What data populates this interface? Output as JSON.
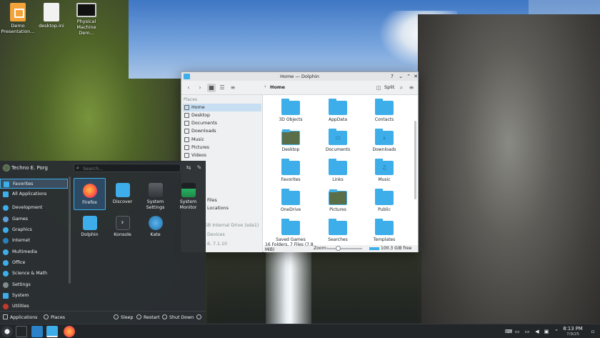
{
  "desktop": {
    "icons": [
      {
        "label_1": "Demo",
        "label_2": "Presentation...",
        "icon": "presentation-icon"
      },
      {
        "label_1": "desktop.ini",
        "label_2": "",
        "icon": "document-icon"
      },
      {
        "label_1": "Physical",
        "label_2": "Machine Dem...",
        "icon": "monitor-icon"
      }
    ]
  },
  "dolphin": {
    "title": "Home — Dolphin",
    "breadcrumb": "Home",
    "split_label": "Split",
    "places_header": "Places",
    "places": [
      "Home",
      "Desktop",
      "Documents",
      "Downloads",
      "Music",
      "Pictures",
      "Videos"
    ],
    "partial_places": [
      "Files",
      "Locations",
      "GB Internal Drive (sda1)",
      "Devices",
      "..6, 7.1.10"
    ],
    "files": [
      {
        "name": "3D Objects",
        "glyph": ""
      },
      {
        "name": "AppData",
        "glyph": ""
      },
      {
        "name": "Contacts",
        "glyph": ""
      },
      {
        "name": "Desktop",
        "glyph": "thumb"
      },
      {
        "name": "Documents",
        "glyph": "▭"
      },
      {
        "name": "Downloads",
        "glyph": "⤓"
      },
      {
        "name": "Favorites",
        "glyph": ""
      },
      {
        "name": "Links",
        "glyph": ""
      },
      {
        "name": "Music",
        "glyph": "♫"
      },
      {
        "name": "OneDrive",
        "glyph": ""
      },
      {
        "name": "Pictures",
        "glyph": "thumb"
      },
      {
        "name": "Public",
        "glyph": ""
      },
      {
        "name": "Saved Games",
        "glyph": ""
      },
      {
        "name": "Searches",
        "glyph": ""
      },
      {
        "name": "Templates",
        "glyph": ""
      }
    ],
    "status": {
      "summary_1": "16 Folders, 7 Files (7.8",
      "summary_2": "MiB)",
      "zoom_label": "Zoom:",
      "free_space": "100.3 GiB free"
    }
  },
  "launcher": {
    "user_name": "Techno E. Porg",
    "search_placeholder": "Search...",
    "categories": [
      "Favorites",
      "All Applications",
      "Development",
      "Games",
      "Graphics",
      "Internet",
      "Multimedia",
      "Office",
      "Science & Math",
      "Settings",
      "System",
      "Utilities"
    ],
    "apps": [
      {
        "name_1": "Firefox",
        "name_2": ""
      },
      {
        "name_1": "Discover",
        "name_2": ""
      },
      {
        "name_1": "System",
        "name_2": "Settings"
      },
      {
        "name_1": "System",
        "name_2": "Monitor"
      },
      {
        "name_1": "Dolphin",
        "name_2": ""
      },
      {
        "name_1": "Konsole",
        "name_2": ""
      },
      {
        "name_1": "Kate",
        "name_2": ""
      }
    ],
    "footer": {
      "applications": "Applications",
      "places": "Places",
      "sleep": "Sleep",
      "restart": "Restart",
      "shutdown": "Shut Down"
    }
  },
  "taskbar": {
    "time": "8:13 PM",
    "date": "7/9/25"
  },
  "colors": {
    "accent": "#3daee9",
    "panel": "#232629",
    "launcher_bg": "#2a2e32"
  }
}
